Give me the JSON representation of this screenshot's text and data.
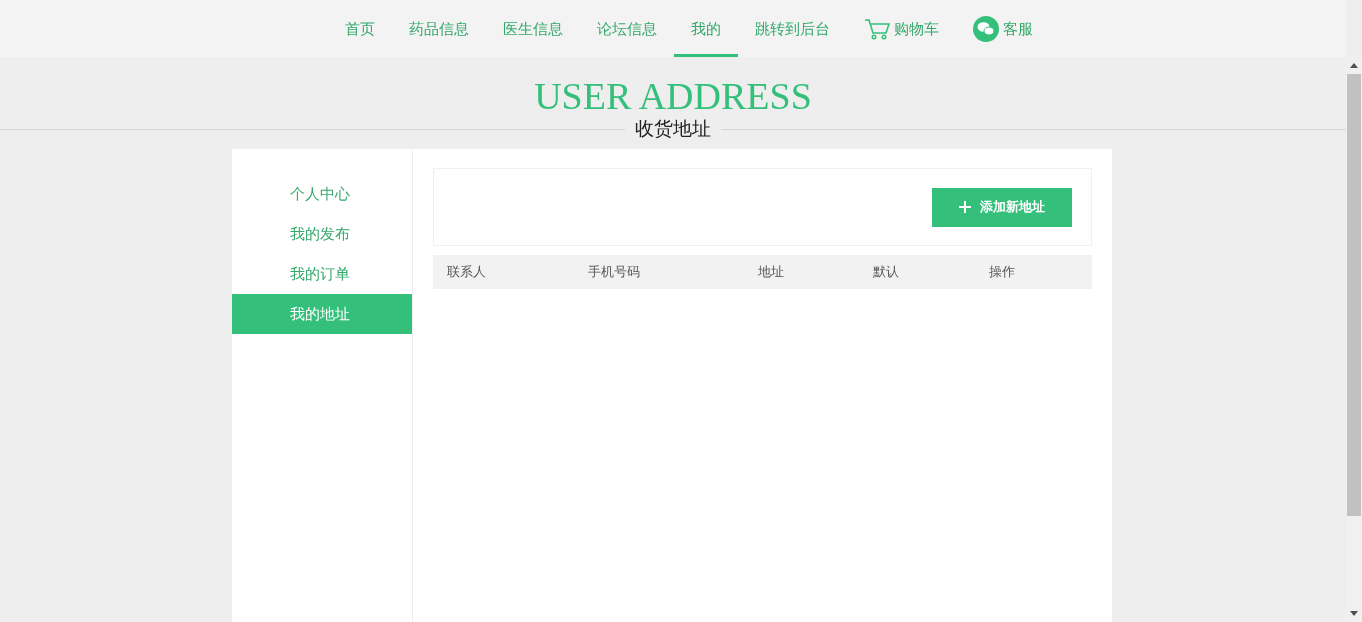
{
  "nav": [
    {
      "label": "首页",
      "kind": "text",
      "selected": false
    },
    {
      "label": "药品信息",
      "kind": "text",
      "selected": false
    },
    {
      "label": "医生信息",
      "kind": "text",
      "selected": false
    },
    {
      "label": "论坛信息",
      "kind": "text",
      "selected": false
    },
    {
      "label": "我的",
      "kind": "text",
      "selected": true
    },
    {
      "label": "跳转到后台",
      "kind": "text",
      "selected": false
    },
    {
      "label": "购物车",
      "kind": "cart",
      "selected": false
    },
    {
      "label": "客服",
      "kind": "chat",
      "selected": false
    }
  ],
  "heading": {
    "title": "USER ADDRESS",
    "subtitle": "收货地址"
  },
  "sidebar": {
    "items": [
      {
        "label": "个人中心",
        "selected": false
      },
      {
        "label": "我的发布",
        "selected": false
      },
      {
        "label": "我的订单",
        "selected": false
      },
      {
        "label": "我的地址",
        "selected": true
      }
    ]
  },
  "toolbar": {
    "add_button": "添加新地址"
  },
  "table": {
    "columns": [
      "联系人",
      "手机号码",
      "地址",
      "默认",
      "操作"
    ]
  }
}
